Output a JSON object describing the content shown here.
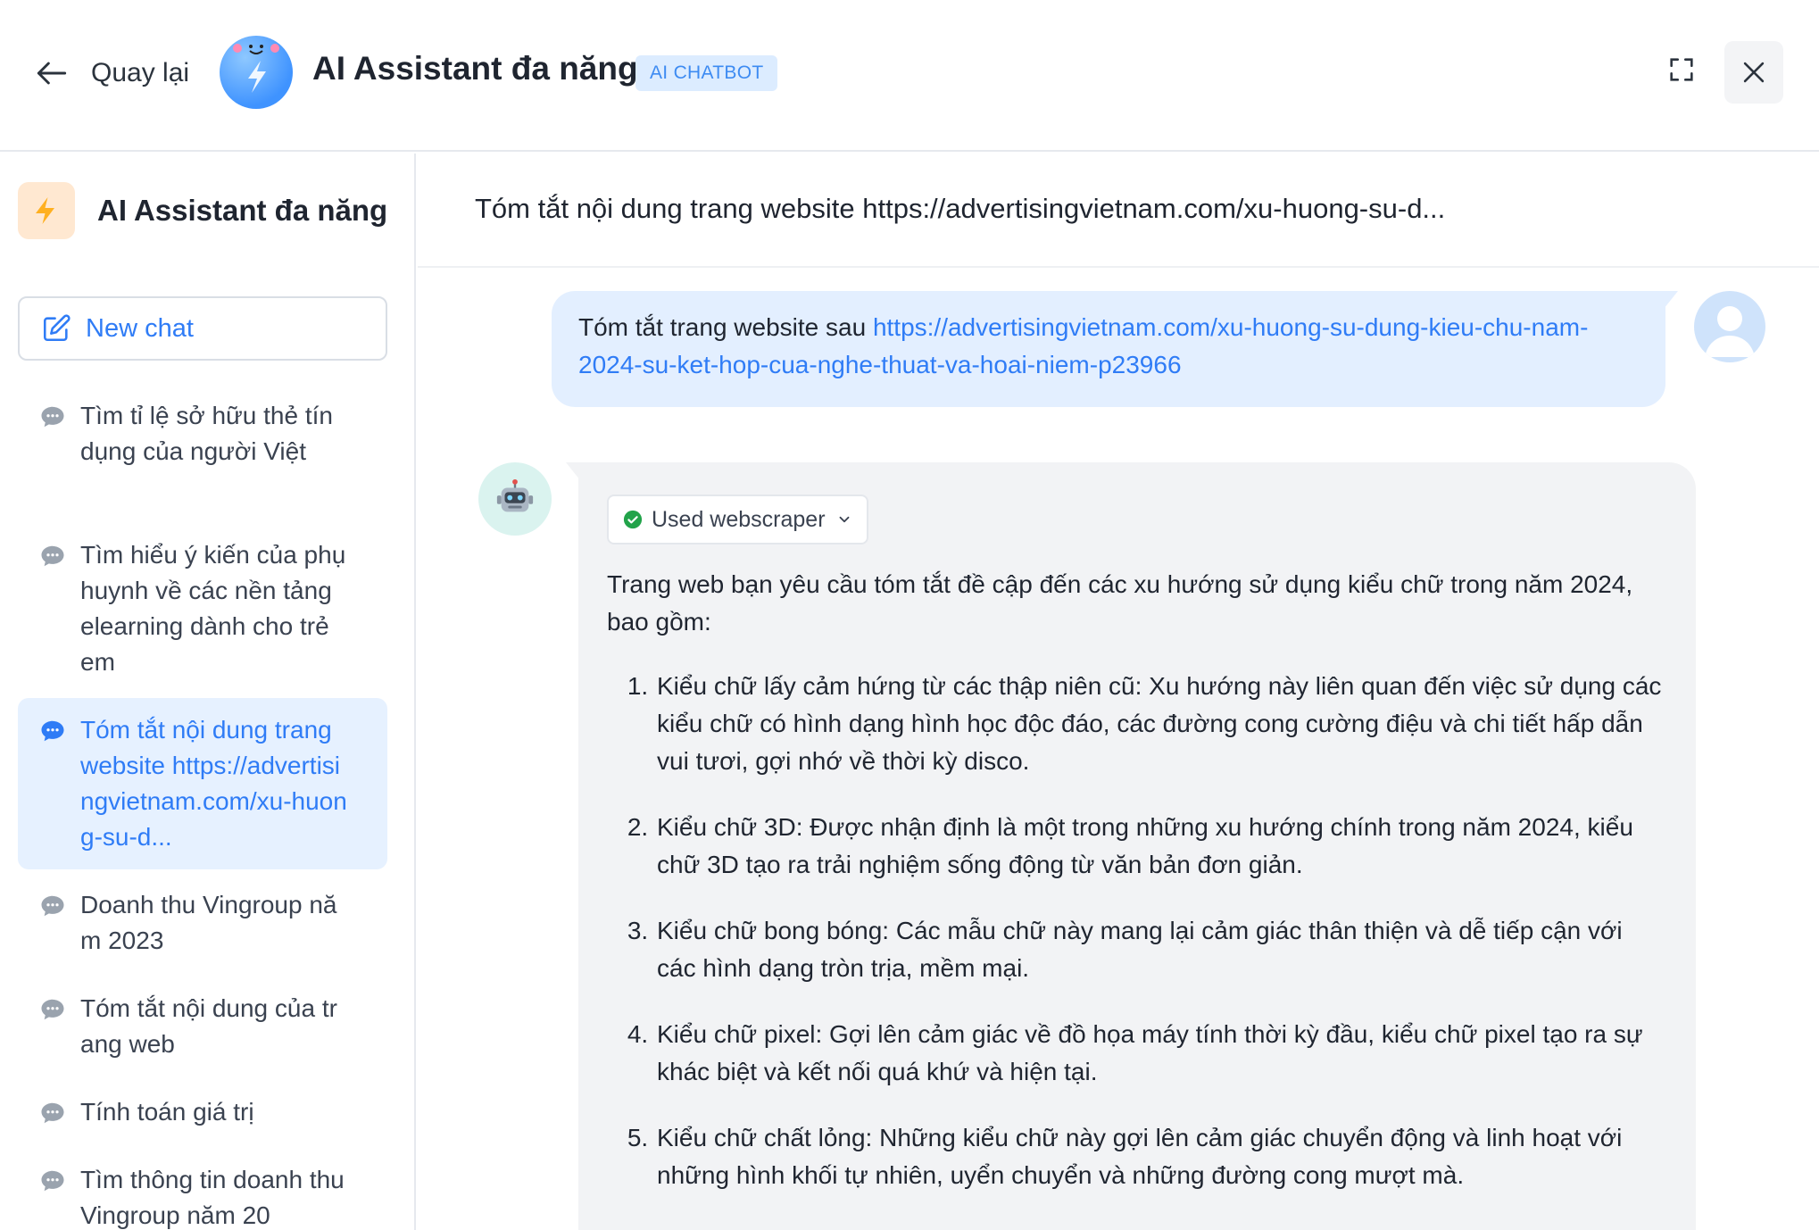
{
  "header": {
    "back_label": "Quay lại",
    "app_title": "AI Assistant đa năng",
    "badge": "AI CHATBOT"
  },
  "sidebar": {
    "title": "AI Assistant đa năng",
    "new_chat_label": "New chat",
    "history": [
      {
        "label": "Tìm tỉ lệ sở hữu thẻ tín dụng của người Việt",
        "active": false
      },
      {
        "label": "Tìm hiểu ý kiến của phụ huynh về các nền tảng elearning dành cho trẻ em",
        "active": false
      },
      {
        "label": "Tóm tắt nội dung trang website https://advertisingvietnam.com/xu-huong-su-d...",
        "active": true
      },
      {
        "label": "Doanh thu Vingroup năm 2023",
        "active": false
      },
      {
        "label": "Tóm tắt nội dung của trang web",
        "active": false
      },
      {
        "label": "Tính toán giá trị",
        "active": false
      },
      {
        "label": "Tìm thông tin doanh thu Vingroup năm 20",
        "active": false
      }
    ]
  },
  "chat": {
    "title": "Tóm tắt nội dung trang website https://advertisingvietnam.com/xu-huong-su-d...",
    "user_message_prefix": "Tóm tắt trang website sau ",
    "user_message_link": "https://advertisingvietnam.com/xu-huong-su-dung-kieu-chu-nam-2024-su-ket-hop-cua-nghe-thuat-va-hoai-niem-p23966",
    "tool_label": "Used webscraper",
    "answer_intro": "Trang web bạn yêu cầu tóm tắt đề cập đến các xu hướng sử dụng kiểu chữ trong năm 2024, bao gồm:",
    "answer_points": [
      "Kiểu chữ lấy cảm hứng từ các thập niên cũ: Xu hướng này liên quan đến việc sử dụng các kiểu chữ có hình dạng hình học độc đáo, các đường cong cường điệu và chi tiết hấp dẫn vui tươi, gợi nhớ về thời kỳ disco.",
      "Kiểu chữ 3D: Được nhận định là một trong những xu hướng chính trong năm 2024, kiểu chữ 3D tạo ra trải nghiệm sống động từ văn bản đơn giản.",
      "Kiểu chữ bong bóng: Các mẫu chữ này mang lại cảm giác thân thiện và dễ tiếp cận với các hình dạng tròn trịa, mềm mại.",
      "Kiểu chữ pixel: Gợi lên cảm giác về đồ họa máy tính thời kỳ đầu, kiểu chữ pixel tạo ra sự khác biệt và kết nối quá khứ và hiện tại.",
      "Kiểu chữ chất lỏng: Những kiểu chữ này gợi lên cảm giác chuyển động và linh hoạt với những hình khối tự nhiên, uyển chuyển và những đường cong mượt mà."
    ]
  },
  "colors": {
    "accent": "#2f7cf6",
    "active_bg": "#e6f1ff",
    "user_bubble": "#e3efff",
    "bot_bubble": "#f2f3f5",
    "success": "#22a34a"
  },
  "icons": {
    "back": "arrow-left-icon",
    "expand": "expand-icon",
    "close": "close-icon",
    "new_chat": "edit-icon",
    "history": "chat-bubble-icon",
    "tool_status": "check-circle-icon",
    "tool_toggle": "chevron-down-icon"
  }
}
